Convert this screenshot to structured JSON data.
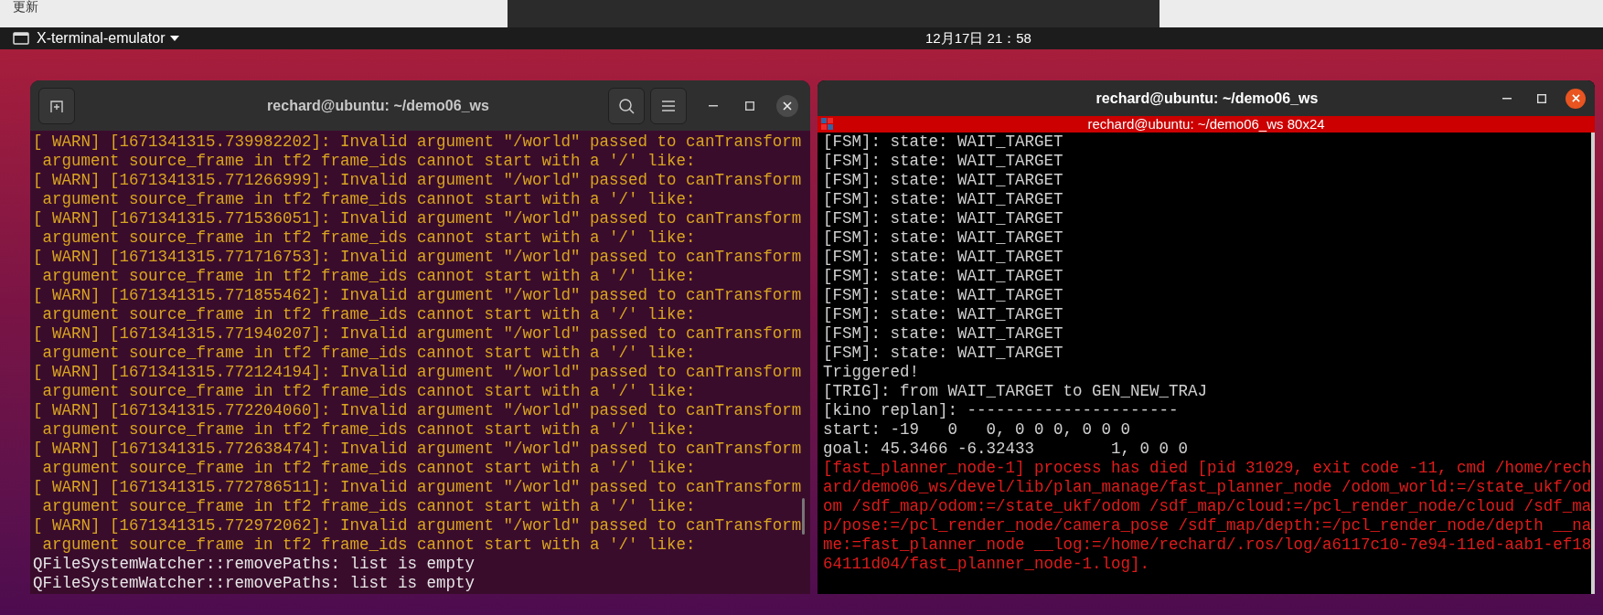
{
  "background_window": {
    "label": "更新"
  },
  "top_bar": {
    "app_menu": "X-terminal-emulator",
    "clock": "12月17日  21：58"
  },
  "left_terminal": {
    "title": "rechard@ubuntu: ~/demo06_ws",
    "lines": [
      {
        "kind": "warn",
        "text": "[ WARN] [1671341315.739982202]: Invalid argument \"/world\" passed to canTransform"
      },
      {
        "kind": "warn",
        "text": " argument source_frame in tf2 frame_ids cannot start with a '/' like:"
      },
      {
        "kind": "warn",
        "text": "[ WARN] [1671341315.771266999]: Invalid argument \"/world\" passed to canTransform"
      },
      {
        "kind": "warn",
        "text": " argument source_frame in tf2 frame_ids cannot start with a '/' like:"
      },
      {
        "kind": "warn",
        "text": "[ WARN] [1671341315.771536051]: Invalid argument \"/world\" passed to canTransform"
      },
      {
        "kind": "warn",
        "text": " argument source_frame in tf2 frame_ids cannot start with a '/' like:"
      },
      {
        "kind": "warn",
        "text": "[ WARN] [1671341315.771716753]: Invalid argument \"/world\" passed to canTransform"
      },
      {
        "kind": "warn",
        "text": " argument source_frame in tf2 frame_ids cannot start with a '/' like:"
      },
      {
        "kind": "warn",
        "text": "[ WARN] [1671341315.771855462]: Invalid argument \"/world\" passed to canTransform"
      },
      {
        "kind": "warn",
        "text": " argument source_frame in tf2 frame_ids cannot start with a '/' like:"
      },
      {
        "kind": "warn",
        "text": "[ WARN] [1671341315.771940207]: Invalid argument \"/world\" passed to canTransform"
      },
      {
        "kind": "warn",
        "text": " argument source_frame in tf2 frame_ids cannot start with a '/' like:"
      },
      {
        "kind": "warn",
        "text": "[ WARN] [1671341315.772124194]: Invalid argument \"/world\" passed to canTransform"
      },
      {
        "kind": "warn",
        "text": " argument source_frame in tf2 frame_ids cannot start with a '/' like:"
      },
      {
        "kind": "warn",
        "text": "[ WARN] [1671341315.772204060]: Invalid argument \"/world\" passed to canTransform"
      },
      {
        "kind": "warn",
        "text": " argument source_frame in tf2 frame_ids cannot start with a '/' like:"
      },
      {
        "kind": "warn",
        "text": "[ WARN] [1671341315.772638474]: Invalid argument \"/world\" passed to canTransform"
      },
      {
        "kind": "warn",
        "text": " argument source_frame in tf2 frame_ids cannot start with a '/' like:"
      },
      {
        "kind": "warn",
        "text": "[ WARN] [1671341315.772786511]: Invalid argument \"/world\" passed to canTransform"
      },
      {
        "kind": "warn",
        "text": " argument source_frame in tf2 frame_ids cannot start with a '/' like:"
      },
      {
        "kind": "warn",
        "text": "[ WARN] [1671341315.772972062]: Invalid argument \"/world\" passed to canTransform"
      },
      {
        "kind": "warn",
        "text": " argument source_frame in tf2 frame_ids cannot start with a '/' like:"
      },
      {
        "kind": "normal",
        "text": "QFileSystemWatcher::removePaths: list is empty"
      },
      {
        "kind": "normal",
        "text": "QFileSystemWatcher::removePaths: list is empty"
      }
    ]
  },
  "right_terminal": {
    "title": "rechard@ubuntu: ~/demo06_ws",
    "subtitle": "rechard@ubuntu: ~/demo06_ws 80x24",
    "lines": [
      {
        "kind": "normal",
        "text": "[FSM]: state: WAIT_TARGET"
      },
      {
        "kind": "normal",
        "text": "[FSM]: state: WAIT_TARGET"
      },
      {
        "kind": "normal",
        "text": "[FSM]: state: WAIT_TARGET"
      },
      {
        "kind": "normal",
        "text": "[FSM]: state: WAIT_TARGET"
      },
      {
        "kind": "normal",
        "text": "[FSM]: state: WAIT_TARGET"
      },
      {
        "kind": "normal",
        "text": "[FSM]: state: WAIT_TARGET"
      },
      {
        "kind": "normal",
        "text": "[FSM]: state: WAIT_TARGET"
      },
      {
        "kind": "normal",
        "text": "[FSM]: state: WAIT_TARGET"
      },
      {
        "kind": "normal",
        "text": "[FSM]: state: WAIT_TARGET"
      },
      {
        "kind": "normal",
        "text": "[FSM]: state: WAIT_TARGET"
      },
      {
        "kind": "normal",
        "text": "[FSM]: state: WAIT_TARGET"
      },
      {
        "kind": "normal",
        "text": "[FSM]: state: WAIT_TARGET"
      },
      {
        "kind": "normal",
        "text": "Triggered!"
      },
      {
        "kind": "normal",
        "text": "[TRIG]: from WAIT_TARGET to GEN_NEW_TRAJ"
      },
      {
        "kind": "normal",
        "text": "[kino replan]: ----------------------"
      },
      {
        "kind": "normal",
        "text": "start: -19   0   0, 0 0 0, 0 0 0"
      },
      {
        "kind": "normal",
        "text": "goal: 45.3466 -6.32433        1, 0 0 0"
      },
      {
        "kind": "error",
        "text": "[fast_planner_node-1] process has died [pid 31029, exit code -11, cmd /home/rech"
      },
      {
        "kind": "error",
        "text": "ard/demo06_ws/devel/lib/plan_manage/fast_planner_node /odom_world:=/state_ukf/od"
      },
      {
        "kind": "error",
        "text": "om /sdf_map/odom:=/state_ukf/odom /sdf_map/cloud:=/pcl_render_node/cloud /sdf_ma"
      },
      {
        "kind": "error",
        "text": "p/pose:=/pcl_render_node/camera_pose /sdf_map/depth:=/pcl_render_node/depth __na"
      },
      {
        "kind": "error",
        "text": "me:=fast_planner_node __log:=/home/rechard/.ros/log/a6117c10-7e94-11ed-aab1-ef18"
      },
      {
        "kind": "error",
        "text": "64111d04/fast_planner_node-1.log]."
      }
    ]
  }
}
